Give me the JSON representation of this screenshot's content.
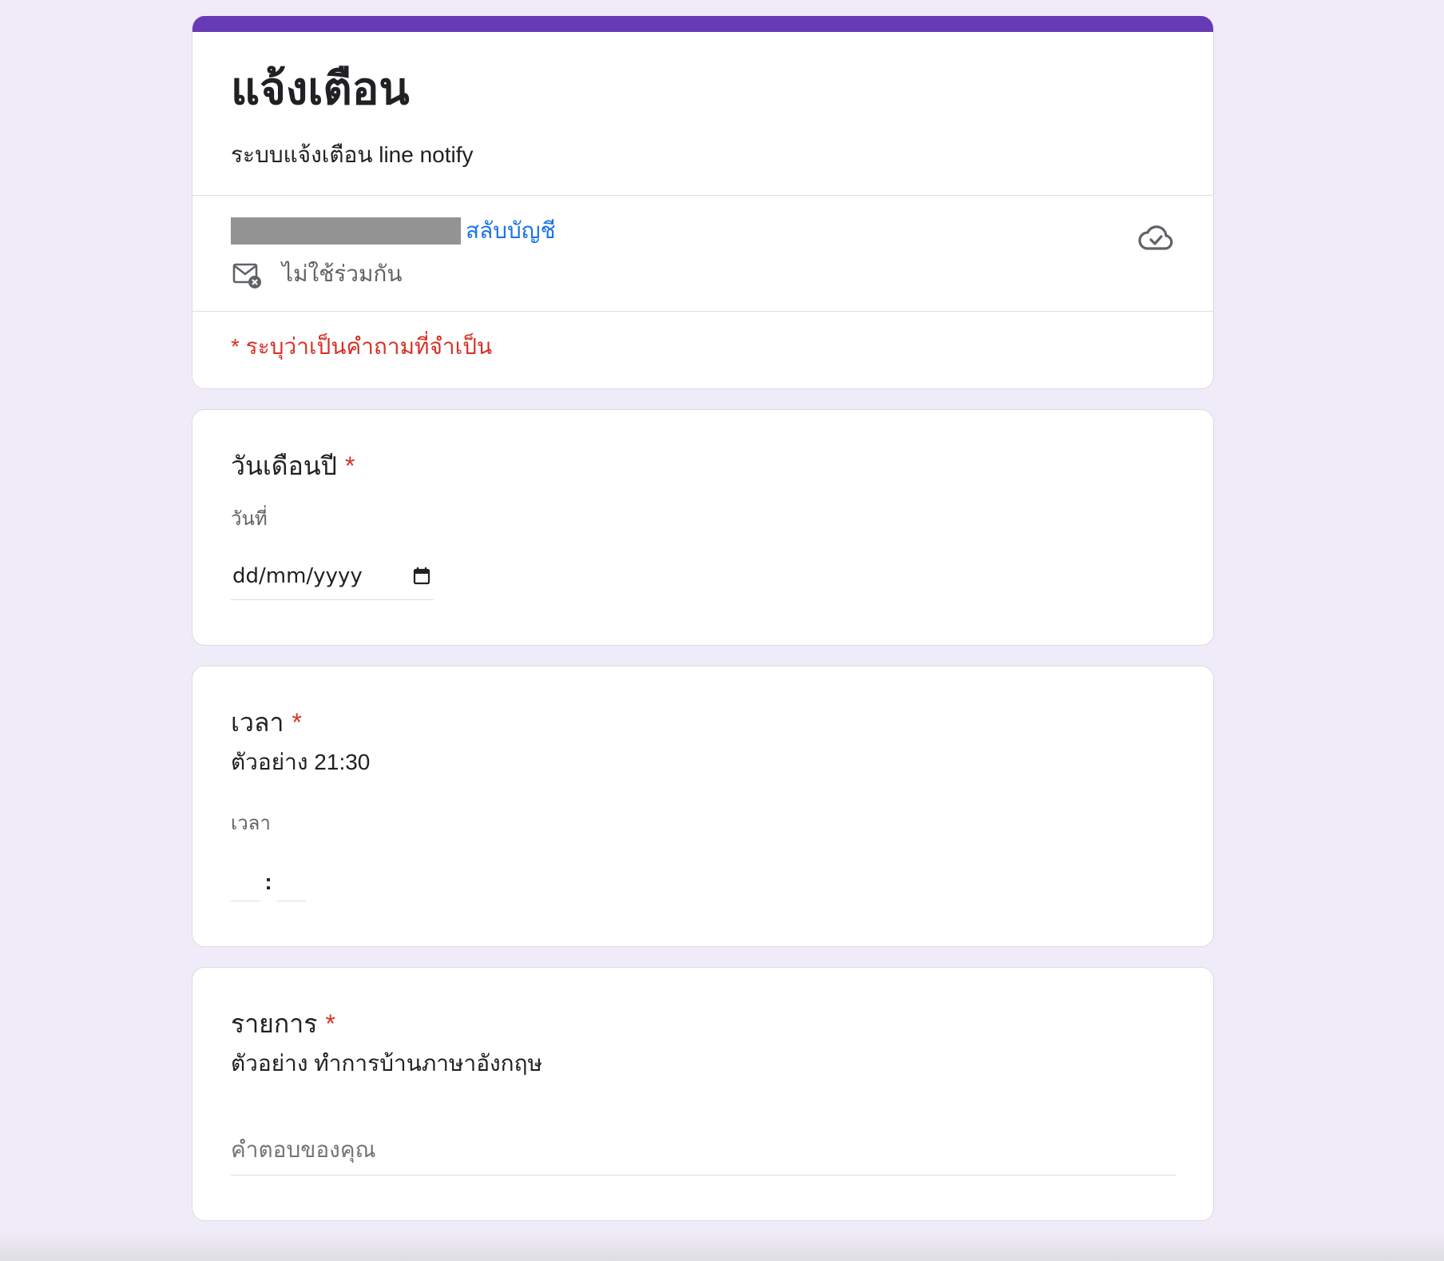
{
  "form": {
    "title": "แจ้งเตือน",
    "description": "ระบบแจ้งเตือน line notify",
    "switch_account": "สลับบัญชี",
    "not_shared": "ไม่ใช้ร่วมกัน",
    "required_note": "* ระบุว่าเป็นคำถามที่จำเป็น",
    "accent_color": "#673ab7"
  },
  "questions": {
    "date": {
      "title": "วันเดือนปี",
      "required_mark": "*",
      "sublabel": "วันที่",
      "value": "dd/mm/yyyy"
    },
    "time": {
      "title": "เวลา",
      "required_mark": "*",
      "description": "ตัวอย่าง 21:30",
      "sublabel": "เวลา",
      "separator": ":"
    },
    "item": {
      "title": "รายการ",
      "required_mark": "*",
      "description": "ตัวอย่าง ทำการบ้านภาษาอังกฤษ",
      "placeholder": "คำตอบของคุณ"
    }
  },
  "icons": {
    "not_shared": "mail-x-icon",
    "cloud": "cloud-check-icon",
    "calendar": "calendar-icon"
  }
}
